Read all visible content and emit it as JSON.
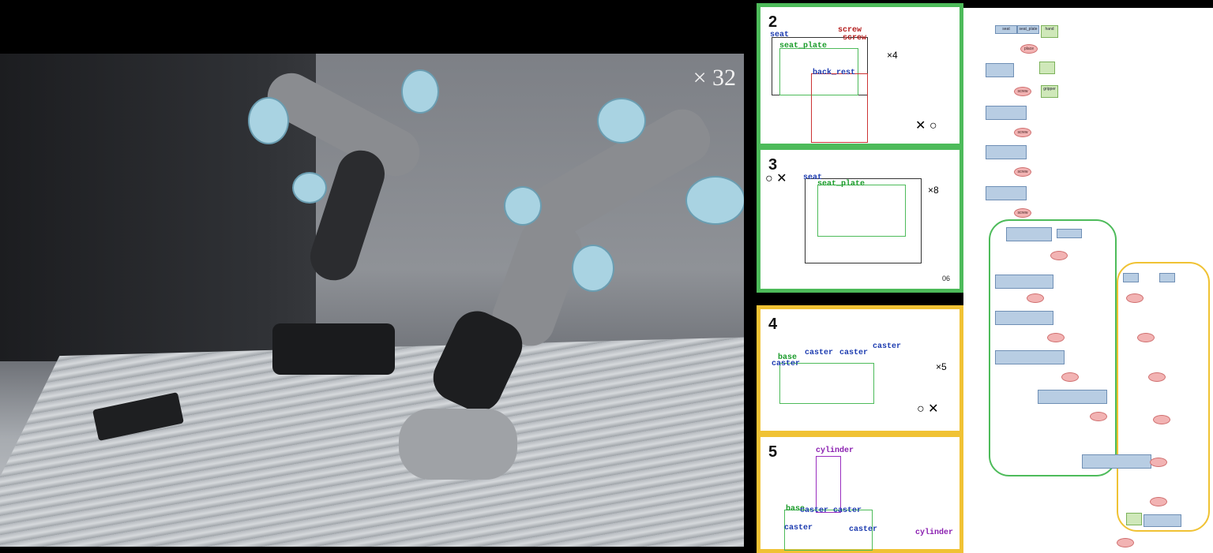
{
  "video": {
    "speed_label": "× 32"
  },
  "manual": {
    "steps": [
      {
        "num": "2",
        "labels": [
          "seat",
          "seat_plate",
          "screw",
          "screw",
          "back_rest"
        ],
        "callout": "×4",
        "page": "06"
      },
      {
        "num": "3",
        "labels": [
          "seat",
          "seat_plate"
        ],
        "callout": "×8"
      },
      {
        "num": "4",
        "labels": [
          "base",
          "caster",
          "caster",
          "caster",
          "caster"
        ],
        "callout": "×5"
      },
      {
        "num": "5",
        "labels": [
          "cylinder",
          "base",
          "caster",
          "caster",
          "caster",
          "caster",
          "cylinder"
        ]
      }
    ]
  },
  "graph": {
    "nodes_top": [
      "seat",
      "seat_plate",
      "hand",
      "gripper"
    ],
    "op_labels": [
      "place",
      "screw",
      "screw",
      "screw",
      "screw"
    ],
    "colors": {
      "object": "#b8cde3",
      "tool": "#cfe8b9",
      "operation": "#f2b3b3",
      "green_group": "#4dbb5a",
      "yellow_group": "#f0c234"
    }
  }
}
